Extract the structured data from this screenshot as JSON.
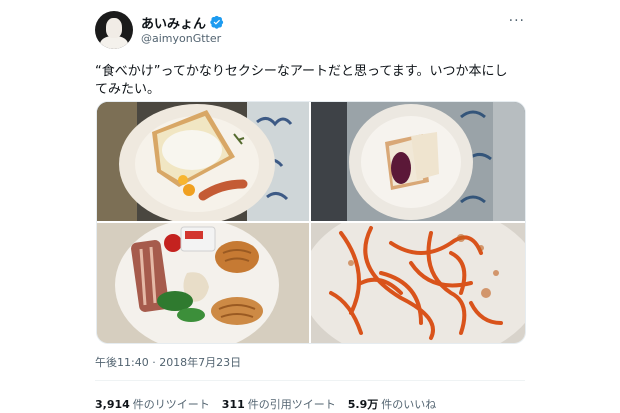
{
  "user": {
    "name": "あいみょん",
    "handle": "@aimyonGtter",
    "verified": true
  },
  "more_label": "···",
  "tweet_text": "“食べかけ”ってかなりセクシーなアートだと思ってます。いつか本にしてみたい。",
  "timestamp": "午後11:40 · 2018年7月23日",
  "stats": {
    "retweets": {
      "count": "3,914",
      "label": "件のリツイート"
    },
    "quotes": {
      "count": "311",
      "label": "件の引用ツイート"
    },
    "likes": {
      "count": "5.9万",
      "label": "件のいいね"
    }
  },
  "colors": {
    "verified_blue": "#1d9bf0",
    "secondary_text": "#536471"
  },
  "photos": [
    "half-eaten-toast-photo",
    "bread-with-jam-photo",
    "breakfast-plate-photo",
    "spaghetti-plate-photo"
  ]
}
